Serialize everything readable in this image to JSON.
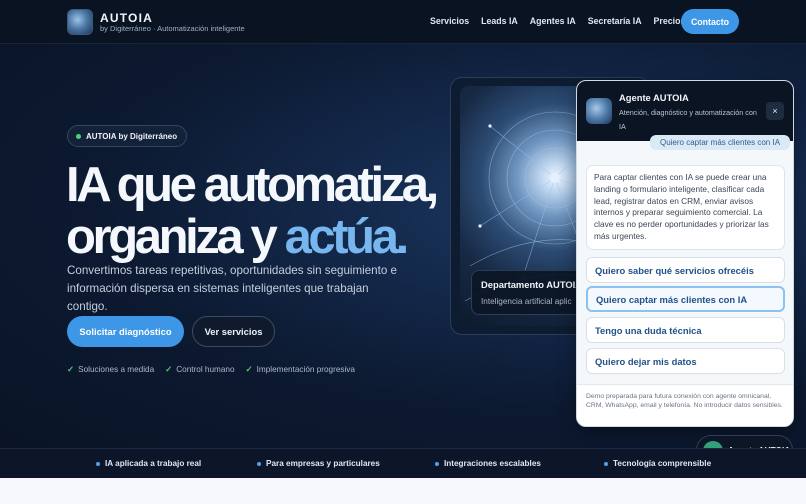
{
  "nav": {
    "brand_name": "AUTOIA",
    "brand_sub": "by Digiterráneo · Automatización inteligente",
    "links": [
      "Servicios",
      "Leads IA",
      "Agentes IA",
      "Secretaría IA",
      "Precios"
    ],
    "cta": "Contacto"
  },
  "hero": {
    "pill": "AUTOIA by Digiterráneo",
    "headline_line1": "IA que automatiza,",
    "headline_line2_prefix": "organiza y ",
    "headline_line2_accent": "actúa.",
    "subtext": "Convertimos tareas repetitivas, oportunidades sin seguimiento e información dispersa en sistemas inteligentes que trabajan contigo.",
    "primary_button": "Solicitar diagnóstico",
    "secondary_button": "Ver servicios",
    "checks": [
      "Soluciones a medida",
      "Control humano",
      "Implementación progresiva"
    ],
    "visual_caption_title": "Departamento AUTOIA",
    "visual_caption_sub": "Inteligencia artificial aplic"
  },
  "chat": {
    "title": "Agente AUTOIA",
    "subtitle": "Atención, diagnóstico y automatización con IA",
    "close": "×",
    "user_message": "Quiero captar más clientes con IA",
    "bot_message": "Para captar clientes con IA se puede crear una landing o formulario inteligente, clasificar cada lead, registrar datos en CRM, enviar avisos internos y preparar seguimiento comercial. La clave es no perder oportunidades y priorizar las más urgentes.",
    "options": [
      "Quiero saber qué servicios ofrecéis",
      "Quiero captar más clientes con IA",
      "Tengo una duda técnica",
      "Quiero dejar mis datos"
    ],
    "footer": "Demo preparada para futura conexión con agente omnicanal, CRM, WhatsApp, email y telefonía. No introducir datos sensibles."
  },
  "fab": {
    "badge": "AI",
    "label": "Agente AUTOIA"
  },
  "strip": [
    "IA aplicada a trabajo real",
    "Para empresas y particulares",
    "Integraciones escalables",
    "Tecnología comprensible"
  ],
  "colors": {
    "accent": "#3d97e6",
    "headline_accent": "#77b6ee",
    "check_green": "#52c878",
    "option_text": "#23528a"
  }
}
